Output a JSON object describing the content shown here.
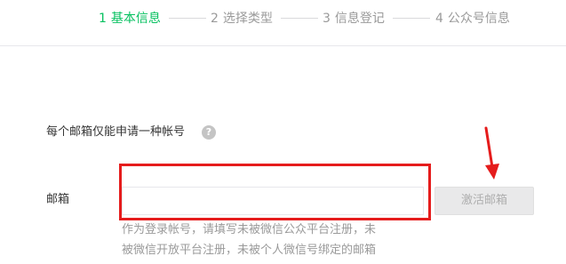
{
  "steps": [
    {
      "num": "1",
      "label": "基本信息"
    },
    {
      "num": "2",
      "label": "选择类型"
    },
    {
      "num": "3",
      "label": "信息登记"
    },
    {
      "num": "4",
      "label": "公众号信息"
    }
  ],
  "form": {
    "note": "每个邮箱仅能申请一种帐号",
    "help_icon": "?",
    "email_label": "邮箱",
    "email_value": "",
    "activate_button": "激活邮箱",
    "hint_line1": "作为登录帐号，请填写未被微信公众平台注册，未",
    "hint_line2": "被微信开放平台注册，未被个人微信号绑定的邮箱"
  },
  "colors": {
    "active_step": "#07c160",
    "annotation_red": "#e51c1c"
  },
  "icons": {
    "help": "question-circle-icon",
    "annotation": "red-arrow-down"
  }
}
